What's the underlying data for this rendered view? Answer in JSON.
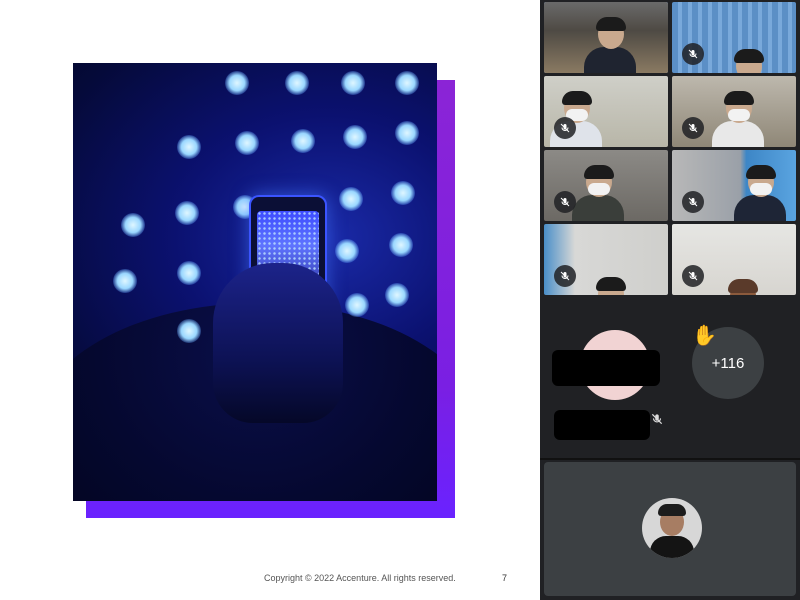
{
  "slide": {
    "copyright": "Copyright © 2022 Accenture. All rights reserved.",
    "page_number": "7"
  },
  "meeting": {
    "participant_tiles": [
      {
        "id": "p1",
        "active": true,
        "muted": false
      },
      {
        "id": "p2",
        "active": false,
        "muted": true
      },
      {
        "id": "p3",
        "active": false,
        "muted": true
      },
      {
        "id": "p4",
        "active": false,
        "muted": true
      },
      {
        "id": "p5",
        "active": false,
        "muted": true
      },
      {
        "id": "p6",
        "active": false,
        "muted": true
      },
      {
        "id": "p7",
        "active": false,
        "muted": true
      },
      {
        "id": "p8",
        "active": false,
        "muted": true
      }
    ],
    "more_participants": "+116",
    "hand_icon": "raised-hand-icon",
    "mute_icon": "mic-off-icon"
  },
  "colors": {
    "panel_bg": "#202124",
    "active_outline": "#8ab4f8",
    "slide_accent": "#8b24d6"
  }
}
